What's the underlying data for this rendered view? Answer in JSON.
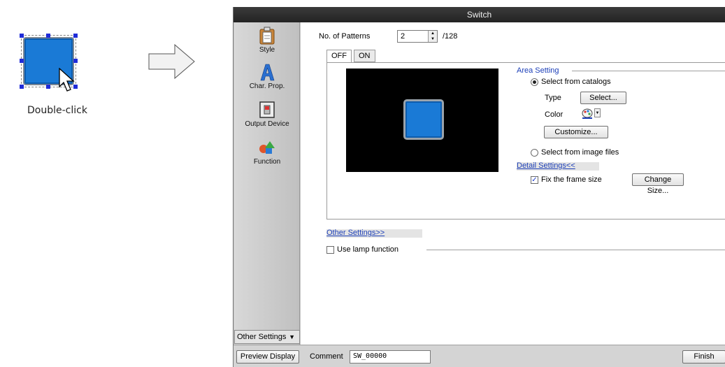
{
  "illustration": {
    "caption": "Double-click"
  },
  "dialog": {
    "title": "Switch",
    "sidebar": {
      "items": [
        {
          "label": "Style",
          "icon": "clipboard-icon"
        },
        {
          "label": "Char. Prop.",
          "icon": "letter-a-icon"
        },
        {
          "label": "Output Device",
          "icon": "switch-device-icon"
        },
        {
          "label": "Function",
          "icon": "shapes-icon"
        }
      ],
      "other_settings": "Other Settings"
    },
    "patterns": {
      "label": "No. of Patterns",
      "value": "2",
      "max": "/128"
    },
    "tabs": [
      "OFF",
      "ON"
    ],
    "area_setting": {
      "title": "Area Setting",
      "select_catalogs": "Select from catalogs",
      "type_label": "Type",
      "select_button": "Select...",
      "color_label": "Color",
      "customize_button": "Customize...",
      "select_image": "Select from image files"
    },
    "detail_settings": {
      "link": "Detail Settings<<",
      "fix_frame": "Fix the frame size",
      "change_size": "Change Size..."
    },
    "other_settings_link": "Other Settings>>",
    "lamp": {
      "label": "Use lamp function"
    },
    "bottom": {
      "preview": "Preview Display",
      "comment_label": "Comment",
      "comment_value": "SW_00000",
      "finish": "Finish"
    }
  }
}
